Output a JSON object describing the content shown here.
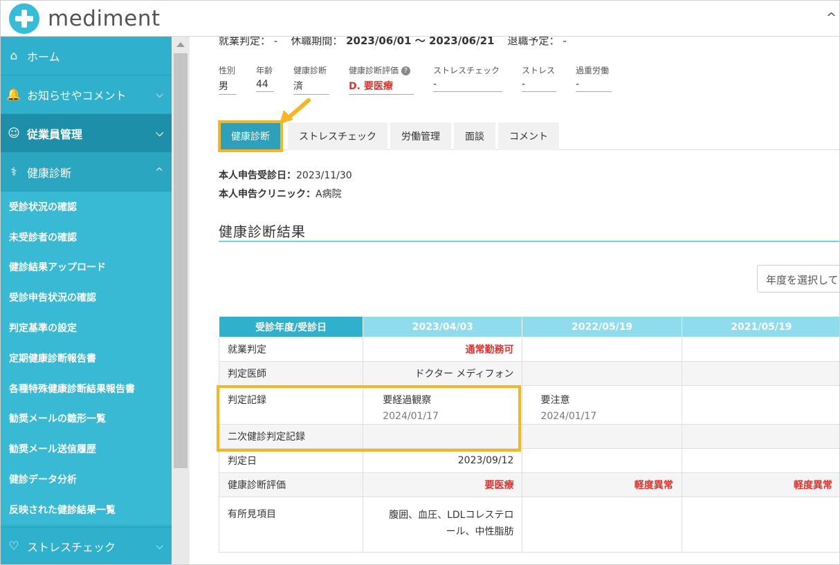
{
  "header": {
    "logo_text": "mediment",
    "chevron": "^"
  },
  "sidebar": {
    "items": [
      {
        "label": "ホーム",
        "icon": "home-icon",
        "glyph": "⌂"
      },
      {
        "label": "お知らせやコメント",
        "icon": "bell-icon",
        "glyph": "🔔"
      },
      {
        "label": "従業員管理",
        "icon": "people-icon",
        "glyph": "👥"
      },
      {
        "label": "健康診断",
        "icon": "stethoscope-icon",
        "glyph": "⚕"
      }
    ],
    "sub_items": [
      "受診状況の確認",
      "未受診者の確認",
      "健診結果アップロード",
      "受診申告状況の確認",
      "判定基準の設定",
      "定期健康診断報告書",
      "各種特殊健康診断結果報告書",
      "勧奨メールの雛形一覧",
      "勧奨メール送信履歴",
      "健診データ分析",
      "反映された健診結果一覧"
    ],
    "bottom_item": {
      "label": "ストレスチェック",
      "icon": "heart-icon",
      "glyph": "♡"
    }
  },
  "status": {
    "employment_label": "就業判定：",
    "employment_value": "-",
    "leave_label": "休職期間：",
    "leave_value": "2023/06/01 〜 2023/06/21",
    "retire_label": "退職予定：",
    "retire_value": "-"
  },
  "fields": [
    {
      "label": "性別",
      "value": "男"
    },
    {
      "label": "年齢",
      "value": "44"
    },
    {
      "label": "健康診断",
      "value": "済"
    },
    {
      "label": "健康診断評価",
      "value": "D. 要医療"
    },
    {
      "label": "ストレスチェック",
      "value": "-"
    },
    {
      "label": "ストレス",
      "value": "-"
    },
    {
      "label": "過重労働",
      "value": "-"
    }
  ],
  "tabs": [
    "健康診断",
    "ストレスチェック",
    "労働管理",
    "面談",
    "コメント"
  ],
  "self_report": {
    "date_label": "本人申告受診日：",
    "date_value": "2023/11/30",
    "clinic_label": "本人申告クリニック：",
    "clinic_value": "A病院"
  },
  "section_title": "健康診断結果",
  "year_select_placeholder": "年度を選択して",
  "table": {
    "header": [
      "受診年度/受診日",
      "2023/04/03",
      "2022/05/19",
      "2021/05/19"
    ],
    "rows": {
      "work": {
        "label": "就業判定",
        "c1": "通常勤務可",
        "c2": "",
        "c3": ""
      },
      "doctor": {
        "label": "判定医師",
        "c1": "ドクター メディフォン",
        "c2": "",
        "c3": ""
      },
      "record": {
        "label": "判定記録",
        "c1": "要経過観察",
        "c1_sub": "2024/01/17",
        "c2": "要注意",
        "c2_sub": "2024/01/17",
        "c3": ""
      },
      "second": {
        "label": "二次健診判定記録",
        "c1": "",
        "c2": "",
        "c3": ""
      },
      "date": {
        "label": "判定日",
        "c1": "2023/09/12",
        "c2": "",
        "c3": ""
      },
      "eval": {
        "label": "健康診断評価",
        "c1": "要医療",
        "c2": "軽度異常",
        "c3": "軽度異常"
      },
      "findings": {
        "label": "有所見項目",
        "c1": "腹囲、血圧、LDLコレステロール、中性脂肪",
        "c2": "",
        "c3": ""
      }
    }
  },
  "colors": {
    "accent": "#2fb0cc",
    "highlight": "#f7b620",
    "alert": "#e0332d"
  }
}
